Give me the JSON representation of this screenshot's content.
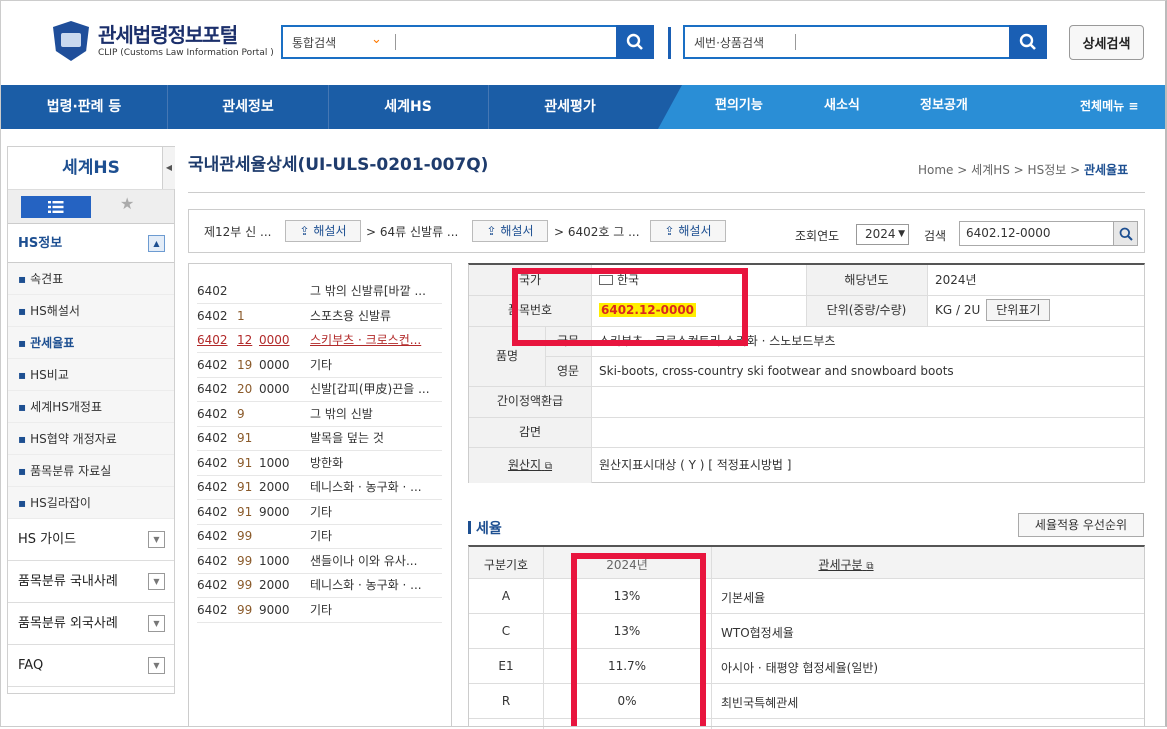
{
  "header": {
    "logo_title": "관세법령정보포털",
    "logo_sub": "CLIP (Customs Law Information Portal )",
    "search1_scope": "통합검색",
    "search2_scope": "세번·상품검색",
    "detail_search": "상세검색"
  },
  "nav": {
    "items": [
      "법령·판례 등",
      "관세정보",
      "세계HS",
      "관세평가"
    ],
    "right_items": [
      "편의기능",
      "새소식",
      "정보공개"
    ],
    "all_menu": "전체메뉴 ≡"
  },
  "sidebar": {
    "title": "세계HS",
    "section": "HS정보",
    "items": [
      "속견표",
      "HS해설서",
      "관세율표",
      "HS비교",
      "세계HS개정표",
      "HS협약 개정자료",
      "품목분류 자료실",
      "HS길라잡이"
    ],
    "groups": [
      "HS 가이드",
      "품목분류 국내사례",
      "품목분류 외국사례",
      "FAQ"
    ]
  },
  "page": {
    "title": "국내관세율상세(UI-ULS-0201-007Q)",
    "breadcrumb": [
      "Home",
      "세계HS",
      "HS정보",
      "관세율표"
    ]
  },
  "category_bar": {
    "part": "제12부 신 ...",
    "chapter": "> 64류 신발류 ...",
    "heading": "> 6402호 그 ...",
    "explain_btn": "해설서",
    "year_label": "조회연도",
    "year_value": "2024",
    "search_label": "검색",
    "search_value": "6402.12-0000"
  },
  "hs_list": [
    {
      "a": "6402",
      "b": "",
      "c": "",
      "desc": "그 밖의 신발류[바깥 ..."
    },
    {
      "a": "6402",
      "b": "1",
      "c": "",
      "desc": "스포츠용 신발류"
    },
    {
      "a": "6402",
      "b": "12",
      "c": "0000",
      "desc": "스키부츠 · 크로스컨...",
      "selected": true
    },
    {
      "a": "6402",
      "b": "19",
      "c": "0000",
      "desc": "기타"
    },
    {
      "a": "6402",
      "b": "20",
      "c": "0000",
      "desc": "신발[갑피(甲皮)끈을 ..."
    },
    {
      "a": "6402",
      "b": "9",
      "c": "",
      "desc": "그 밖의 신발"
    },
    {
      "a": "6402",
      "b": "91",
      "c": "",
      "desc": "발목을 덮는 것"
    },
    {
      "a": "6402",
      "b": "91",
      "c": "1000",
      "desc": "방한화"
    },
    {
      "a": "6402",
      "b": "91",
      "c": "2000",
      "desc": "테니스화 · 농구화 · ..."
    },
    {
      "a": "6402",
      "b": "91",
      "c": "9000",
      "desc": "기타"
    },
    {
      "a": "6402",
      "b": "99",
      "c": "",
      "desc": "기타"
    },
    {
      "a": "6402",
      "b": "99",
      "c": "1000",
      "desc": "샌들이나 이와 유사..."
    },
    {
      "a": "6402",
      "b": "99",
      "c": "2000",
      "desc": "테니스화 · 농구화 · ..."
    },
    {
      "a": "6402",
      "b": "99",
      "c": "9000",
      "desc": "기타"
    }
  ],
  "detail": {
    "country_label": "국가",
    "country_value": "한국",
    "year_label": "해당년도",
    "year_value": "2024년",
    "hs_label": "품목번호",
    "hs_value": "6402.12-0000",
    "unit_label": "단위(중량/수량)",
    "unit_value": "KG / 2U",
    "unit_btn": "단위표기",
    "name_label": "품명",
    "kor_label": "국문",
    "kor_value": "스키부츠 · 크로스컨트리 스키화 · 스노보드부츠",
    "eng_label": "영문",
    "eng_value": "Ski-boots, cross-country ski footwear and snowboard boots",
    "refund_label": "간이정액환급",
    "exempt_label": "감면",
    "origin_label": "원산지",
    "origin_value": "원산지표시대상 ( Y ) [ 적정표시방법 ]"
  },
  "tax": {
    "title": "세율",
    "priority_btn": "세율적용 우선순위",
    "headers": [
      "구분기호",
      "2024년",
      "관세구분"
    ],
    "rows": [
      {
        "code": "A",
        "rate": "13%",
        "type": "기본세율"
      },
      {
        "code": "C",
        "rate": "13%",
        "type": "WTO협정세율"
      },
      {
        "code": "E1",
        "rate": "11.7%",
        "type": "아시아 · 태평양 협정세율(일반)"
      },
      {
        "code": "R",
        "rate": "0%",
        "type": "최빈국특혜관세"
      }
    ]
  }
}
